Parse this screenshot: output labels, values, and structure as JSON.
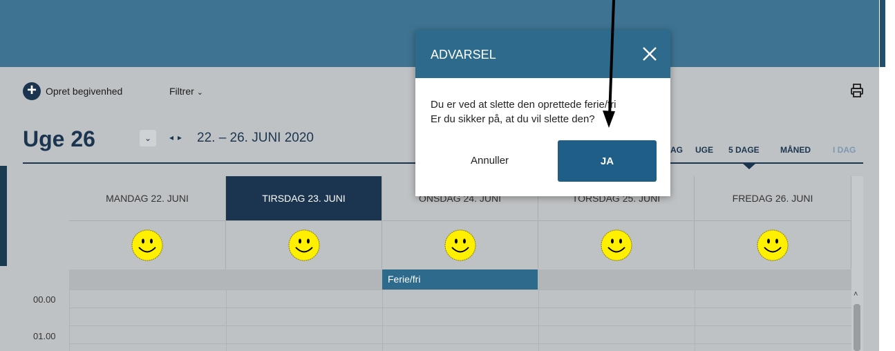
{
  "toolbar": {
    "add_label": "Opret begivenhed",
    "filter_label": "Filtrer",
    "chevron": "⌄"
  },
  "week": {
    "title": "Uge 26",
    "range": "22. – 26. JUNI 2020",
    "prev": "◂",
    "next": "▸"
  },
  "views": [
    {
      "label": "AG",
      "active": false
    },
    {
      "label": "UGE",
      "active": false
    },
    {
      "label": "5 DAGE",
      "active": true
    },
    {
      "label": "MÅNED",
      "active": false
    },
    {
      "label": "I DAG",
      "active": false
    }
  ],
  "days": [
    {
      "label": "MANDAG 22. JUNI",
      "active": false
    },
    {
      "label": "TIRSDAG 23. JUNI",
      "active": true
    },
    {
      "label": "ONSDAG 24. JUNI",
      "active": false
    },
    {
      "label": "TORSDAG 25. JUNI",
      "active": false
    },
    {
      "label": "FREDAG 26. JUNI",
      "active": false
    }
  ],
  "event": {
    "label": "Ferie/fri"
  },
  "times": [
    "00.00",
    "01.00"
  ],
  "modal": {
    "title": "ADVARSEL",
    "message_line1": "Du er ved at slette den oprettede ferie/fri",
    "message_line2": "Er du sikker på, at du vil slette den?",
    "cancel_label": "Annuller",
    "confirm_label": "JA"
  },
  "colors": {
    "header": "#2d6a8c",
    "navy": "#1b3550",
    "event": "#2d6a8c"
  },
  "icons": {
    "add": "plus-circle-icon",
    "print": "printer-icon",
    "close": "close-icon",
    "smiley": "smiley-face-icon"
  }
}
